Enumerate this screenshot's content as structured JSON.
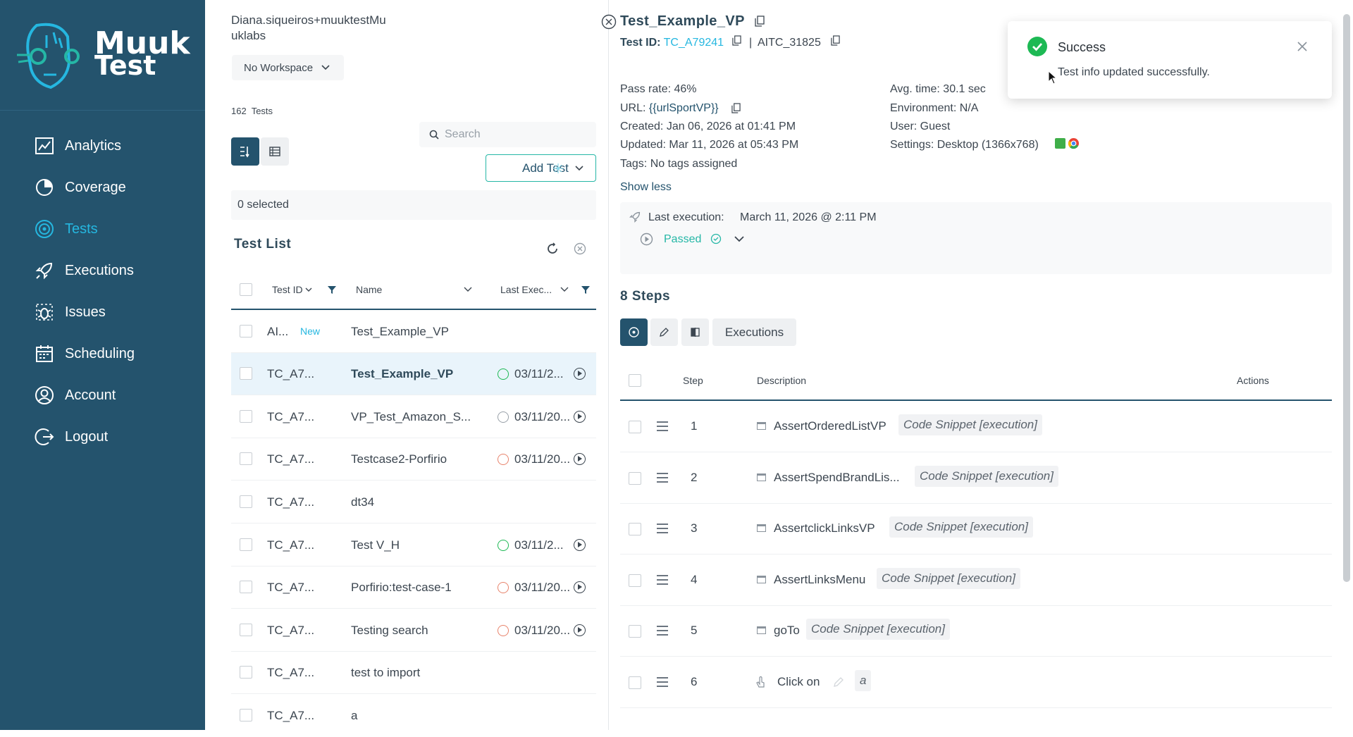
{
  "brand": {
    "line1": "Muuk",
    "line2": "Test"
  },
  "sidebar": {
    "items": [
      {
        "label": "Analytics",
        "icon": "analytics-icon"
      },
      {
        "label": "Coverage",
        "icon": "coverage-icon"
      },
      {
        "label": "Tests",
        "icon": "tests-icon",
        "active": true
      },
      {
        "label": "Executions",
        "icon": "rocket-icon"
      },
      {
        "label": "Issues",
        "icon": "bug-icon"
      },
      {
        "label": "Scheduling",
        "icon": "calendar-icon"
      },
      {
        "label": "Account",
        "icon": "user-icon"
      },
      {
        "label": "Logout",
        "icon": "logout-icon"
      }
    ]
  },
  "middle": {
    "user_line1": "Diana.siqueiros+muuktestMu",
    "user_line2": "uklabs",
    "workspace": "No Workspace",
    "tests_count": "162",
    "tests_label": "Tests",
    "search_placeholder": "Search",
    "add_test_label": "Add Test",
    "selected_text": "0 selected",
    "list_title": "Test List",
    "columns": {
      "id": "Test ID",
      "name": "Name",
      "last_exec": "Last Exec..."
    },
    "rows": [
      {
        "id": "AI...",
        "badge": "New",
        "name": "Test_Example_VP",
        "status": "",
        "date": ""
      },
      {
        "id": "TC_A7...",
        "name": "Test_Example_VP",
        "status": "passed",
        "date": "03/11/2...",
        "selected": true
      },
      {
        "id": "TC_A7...",
        "name": "VP_Test_Amazon_S...",
        "status": "skipped",
        "date": "03/11/20..."
      },
      {
        "id": "TC_A7...",
        "name": "Testcase2-Porfirio",
        "status": "error",
        "date": "03/11/20..."
      },
      {
        "id": "TC_A7...",
        "name": "dt34",
        "status": "",
        "date": ""
      },
      {
        "id": "TC_A7...",
        "name": "Test V_H",
        "status": "passed",
        "date": "03/11/2..."
      },
      {
        "id": "TC_A7...",
        "name": "Porfirio:test-case-1",
        "status": "error",
        "date": "03/11/20..."
      },
      {
        "id": "TC_A7...",
        "name": "Testing search",
        "status": "error",
        "date": "03/11/20..."
      },
      {
        "id": "TC_A7...",
        "name": "test to import",
        "status": "",
        "date": ""
      },
      {
        "id": "TC_A7...",
        "name": "a",
        "status": "",
        "date": ""
      }
    ]
  },
  "detail": {
    "title": "Test_Example_VP",
    "test_id_label": "Test ID:",
    "test_id": "TC_A79241",
    "separator": "|",
    "aitc": "AITC_31825",
    "pass_rate": "Pass rate: 46%",
    "url_label": "URL:",
    "url_value": "{{urlSportVP}}",
    "created": "Created: Jan 06, 2026 at 01:41 PM",
    "updated": "Updated: Mar 11, 2026 at 05:43 PM",
    "tags": "Tags: No tags assigned",
    "avg_time": "Avg. time: 30.1 sec",
    "environment": "Environment: N/A",
    "user": "User: Guest",
    "settings": "Settings: Desktop (1366x768)",
    "show_less": "Show less",
    "last_exec_label": "Last execution:",
    "last_exec_value": "March 11, 2026 @ 2:11 PM",
    "passed_label": "Passed",
    "steps_title": "8 Steps",
    "executions_tab": "Executions",
    "steps_columns": {
      "step": "Step",
      "description": "Description",
      "actions": "Actions"
    },
    "steps": [
      {
        "num": "1",
        "name": "AssertOrderedListVP",
        "tag": "Code Snippet [execution]"
      },
      {
        "num": "2",
        "name": "AssertSpendBrandLis...",
        "tag": "Code Snippet [execution]"
      },
      {
        "num": "3",
        "name": "AssertclickLinksVP",
        "tag": "Code Snippet [execution]"
      },
      {
        "num": "4",
        "name": "AssertLinksMenu",
        "tag": "Code Snippet [execution]"
      },
      {
        "num": "5",
        "name": "goTo",
        "tag": "Code Snippet [execution]"
      },
      {
        "num": "6",
        "name": "Click on",
        "tag": "a"
      }
    ]
  },
  "toast": {
    "title": "Success",
    "message": "Test info updated successfully."
  },
  "colors": {
    "sidebar": "#24536d",
    "accent": "#25b7e0",
    "teal": "#25b7a6",
    "success": "#1db954",
    "error": "#e8836b"
  }
}
